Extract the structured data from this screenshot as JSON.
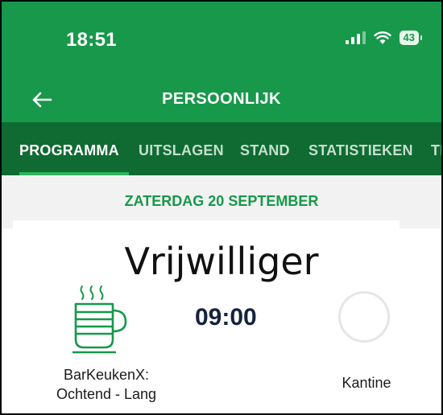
{
  "status_bar": {
    "time": "18:51",
    "battery": "43",
    "icons": [
      "signal-icon",
      "wifi-icon",
      "battery-icon"
    ]
  },
  "app_bar": {
    "title": "PERSOONLIJK",
    "back_icon": "arrow-left-icon"
  },
  "tabs": [
    {
      "label": "PROGRAMMA",
      "active": true
    },
    {
      "label": "UITSLAGEN",
      "active": false
    },
    {
      "label": "STAND",
      "active": false
    },
    {
      "label": "STATISTIEKEN",
      "active": false
    },
    {
      "label": "TE",
      "active": false
    }
  ],
  "date_header": "ZATERDAG 20 SEPTEMBER",
  "overlay_label": "Vrijwilliger",
  "event": {
    "activity_line1": "BarKeukenX:",
    "activity_line2": "Ochtend - Lang",
    "time": "09:00",
    "location": "Kantine",
    "activity_icon": "coffee-cup-icon",
    "location_icon": "circle-placeholder-icon"
  },
  "colors": {
    "primary_green": "#17984a",
    "dark_green": "#0f6b32",
    "time_text": "#16233d",
    "date_band": "#f2f2f2"
  }
}
